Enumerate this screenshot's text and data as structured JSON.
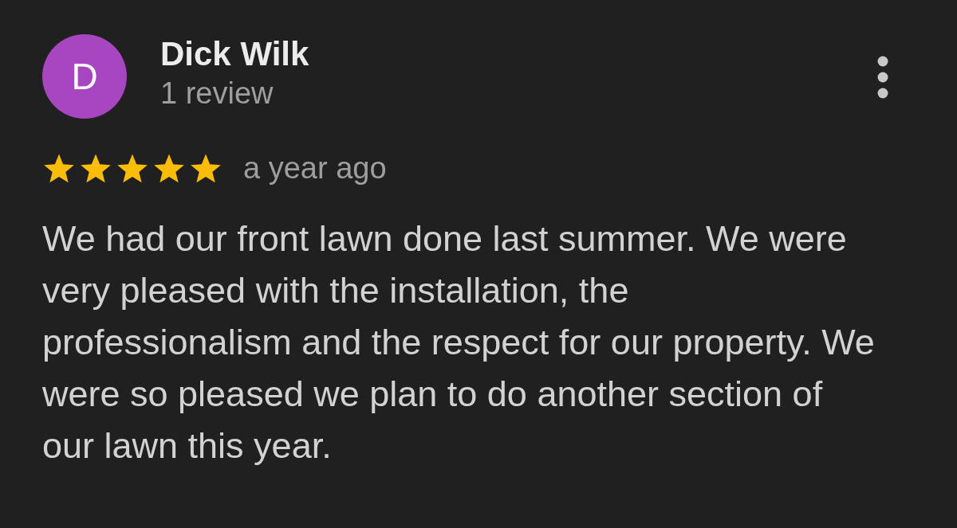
{
  "review": {
    "avatar_letter": "D",
    "author": "Dick Wilk",
    "author_meta": "1 review",
    "stars": 5,
    "time": "a year ago",
    "text": "We had our front lawn done last summer. We were very pleased with the installation, the professionalism and the respect for our property. We were so pleased we plan to do another section of our lawn this year."
  }
}
